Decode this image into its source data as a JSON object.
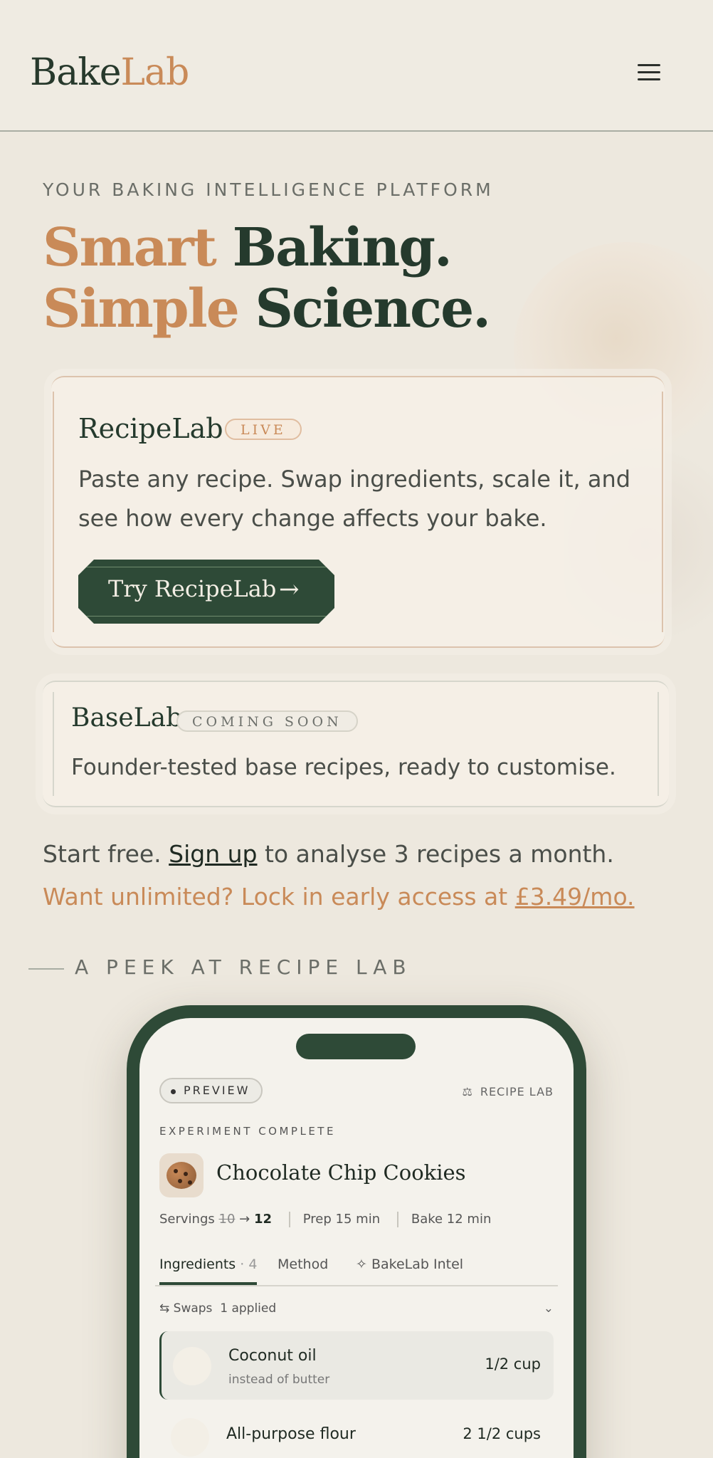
{
  "header": {
    "logo_part1": "Bake",
    "logo_part2": "Lab",
    "menu_icon": "hamburger-menu-icon"
  },
  "hero": {
    "eyebrow": "YOUR BAKING INTELLIGENCE PLATFORM",
    "line1_accent": "Smart",
    "line1_rest": " Baking.",
    "line2_accent": "Simple",
    "line2_rest": " Science."
  },
  "recipelab_card": {
    "title": "RecipeLab",
    "badge": "LIVE",
    "description_line1": "Paste any recipe. Swap ingredients, scale it, and",
    "description_line2": "see how every change affects your bake.",
    "cta_label": "Try RecipeLab",
    "cta_arrow": "→"
  },
  "baselab_card": {
    "title": "BaseLab",
    "badge": "COMING SOON",
    "description": "Founder-tested base recipes, ready to customise."
  },
  "signup": {
    "before": "Start free. ",
    "link": "Sign up",
    "after": " to analyse 3 recipes a month.",
    "unlimited_before": "Want unlimited? Lock in early access at ",
    "price_link": "£3.49/mo."
  },
  "peek": {
    "label": "A PEEK AT RECIPE LAB"
  },
  "phone": {
    "preview_badge": "PREVIEW",
    "recipe_lab_label": "RECIPE LAB",
    "recipe_lab_icon": "scale-icon",
    "status": "EXPERIMENT COMPLETE",
    "recipe_title": "Chocolate Chip Cookies",
    "servings_label": "Servings",
    "servings_old": "10",
    "servings_arrow": "→",
    "servings_new": "12",
    "prep": "Prep 15 min",
    "bake": "Bake 12 min",
    "tabs": [
      {
        "label": "Ingredients",
        "count": " · 4"
      },
      {
        "label": "Method"
      },
      {
        "label": "BakeLab Intel",
        "icon": "sparkle-icon"
      }
    ],
    "swaps": {
      "icon": "swap-arrows-icon",
      "label": "Swaps",
      "applied": "1 applied",
      "chevron": "⌄"
    },
    "ingredients": [
      {
        "name": "Coconut oil",
        "note": "instead of butter",
        "qty": "1/2 cup",
        "icon": "jar-icon"
      },
      {
        "name": "All-purpose flour",
        "qty": "2 1/2 cups",
        "icon": "flour-icon"
      }
    ]
  }
}
